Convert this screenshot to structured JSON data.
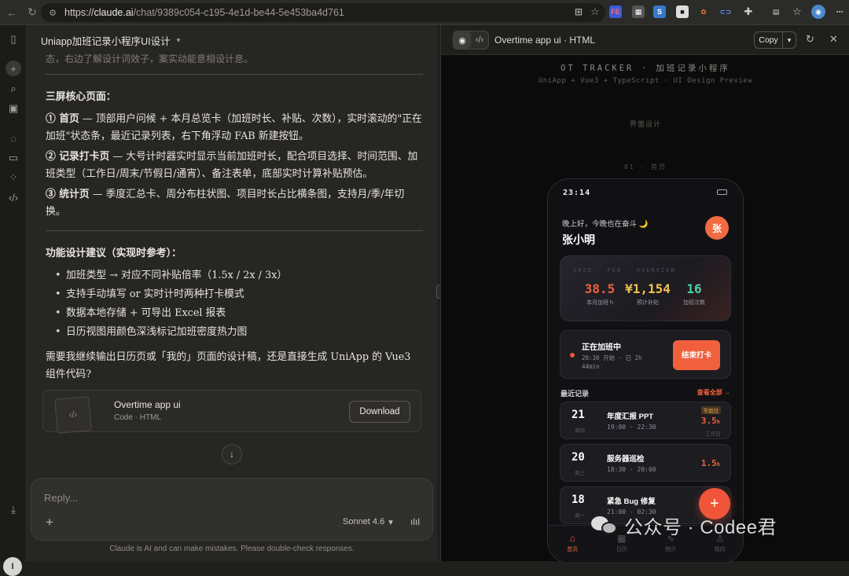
{
  "browser": {
    "url_host": "claude.ai",
    "url_scheme": "https://",
    "url_path": "/chat/9389c054-c195-4e1d-be44-5e453ba4d761"
  },
  "chat": {
    "title": "Uniapp加班记录小程序UI设计",
    "top_fragment": "态，右边了解设计词效子，案实动能意相设计息。",
    "screens_heading": "三屏核心页面：",
    "screens": [
      {
        "name": "① 首页",
        "desc": " — 顶部用户问候 + 本月总览卡（加班时长、补贴、次数），实时滚动的\"正在加班\"状态条，最近记录列表，右下角浮动 FAB 新建按钮。"
      },
      {
        "name": "② 记录打卡页",
        "desc": " — 大号计时器实时显示当前加班时长，配合项目选择、时间范围、加班类型（工作日/周末/节假日/通宵）、备注表单，底部实时计算补贴预估。"
      },
      {
        "name": "③ 统计页",
        "desc": " — 季度汇总卡、周分布柱状图、项目时长占比横条图，支持月/季/年切换。"
      }
    ],
    "suggest_heading": "功能设计建议（实现时参考）：",
    "suggestions": [
      "加班类型 → 对应不同补贴倍率（1.5x / 2x / 3x）",
      "支持手动填写 or 实时计时两种打卡模式",
      "数据本地存储 + 可导出 Excel 报表",
      "日历视图用颜色深浅标记加班密度热力图"
    ],
    "question": "需要我继续输出日历页或「我的」页面的设计稿，还是直接生成 UniApp 的 Vue3 组件代码?",
    "artifact_name": "Overtime app ui",
    "artifact_type": "Code · HTML",
    "download_label": "Download",
    "reply_placeholder": "Reply...",
    "model_label": "Sonnet 4.6",
    "disclaimer": "Claude is AI and can make mistakes. Please double-check responses.",
    "user_initial": "I"
  },
  "preview": {
    "title": "Overtime app ui · HTML",
    "copy_label": "Copy",
    "tracker_title": "OT TRACKER · 加班记录小程序",
    "tracker_sub": "UniApp + Vue3 + TypeScript · UI Design Preview",
    "section_label": "界面设计",
    "page_label": "01 · 首页",
    "phone": {
      "time": "23:14",
      "greeting": "晚上好，今晚也在奋斗 🌙",
      "user_name": "张小明",
      "avatar_char": "张",
      "summary_kicker": "2025 · FEB · OVERVIEW",
      "stats": [
        {
          "value": "38.5",
          "label": "本月加班 h",
          "color": "#f0603d"
        },
        {
          "value": "¥1,154",
          "label": "预计补贴",
          "color": "#f2c14e"
        },
        {
          "value": "16",
          "label": "加班次数",
          "color": "#4fd1a5"
        }
      ],
      "ongoing_title": "正在加班中",
      "ongoing_sub": "20:30 开始 · 已 2h 44min",
      "ongoing_button": "结束打卡",
      "records_heading": "最近记录",
      "records_all": "查看全部 →",
      "records": [
        {
          "day": "21",
          "weekday": "周四",
          "title": "年度汇报 PPT",
          "time": "19:00 - 22:30",
          "hours": "3.5",
          "unit": "h",
          "badge": "节假日",
          "extra": "工作日"
        },
        {
          "day": "20",
          "weekday": "周三",
          "title": "服务器巡检",
          "time": "18:30 - 20:00",
          "hours": "1.5",
          "unit": "h",
          "badge": "",
          "extra": ""
        },
        {
          "day": "18",
          "weekday": "周一",
          "title": "紧急 Bug 修复",
          "time": "21:00 - 02:30",
          "hours": "",
          "unit": "",
          "badge": "",
          "extra": ""
        }
      ],
      "fab_label": "+",
      "tabs": [
        {
          "icon": "⌂",
          "label": "首页"
        },
        {
          "icon": "▦",
          "label": "日历"
        },
        {
          "icon": "∿",
          "label": "统计"
        },
        {
          "icon": "♙",
          "label": "我的"
        }
      ]
    }
  },
  "watermark": {
    "text": "公众号 · Codee君"
  },
  "colors": {
    "accent": "#f0603d",
    "gold": "#f2c14e",
    "teal": "#4fd1a5",
    "chat_bg": "#262624",
    "preview_bg": "#0b0b0c"
  }
}
